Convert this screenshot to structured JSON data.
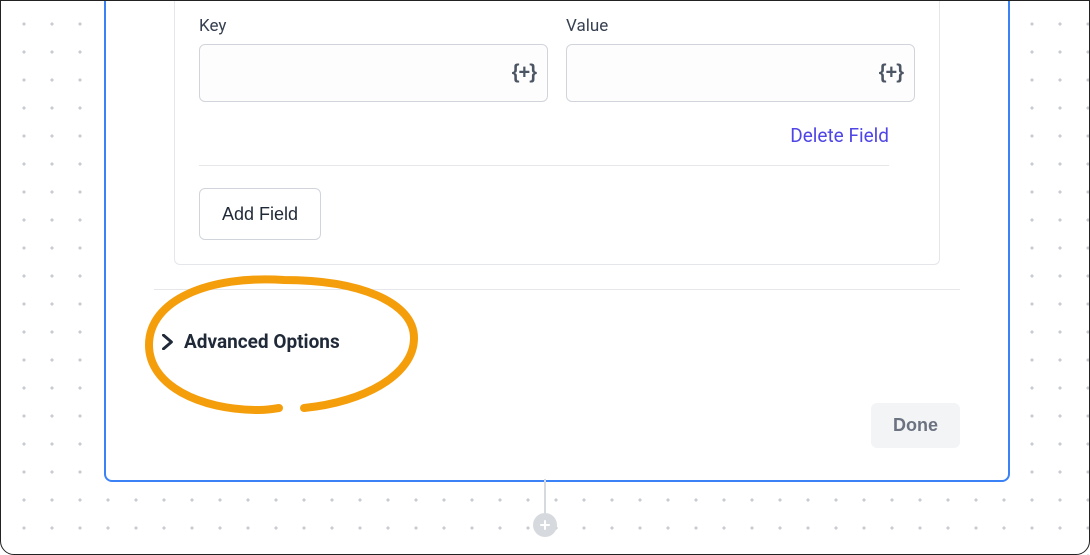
{
  "fields": {
    "key_label": "Key",
    "value_label": "Value",
    "key_value": "",
    "value_value": ""
  },
  "actions": {
    "delete_field": "Delete Field",
    "add_field": "Add Field",
    "done": "Done"
  },
  "advanced": {
    "label": "Advanced Options"
  },
  "icons": {
    "inject": "{+}"
  }
}
